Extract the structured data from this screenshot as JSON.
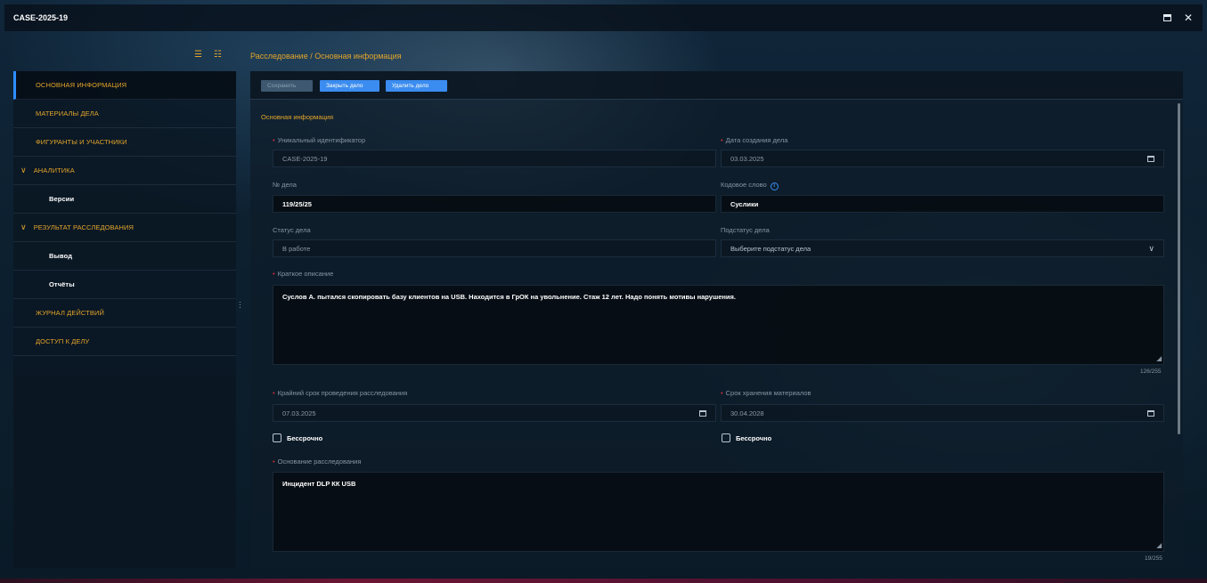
{
  "window": {
    "title": "CASE-2025-19"
  },
  "breadcrumb": "Расследование / Основная информация",
  "sidebar": {
    "items": [
      {
        "label": "ОСНОВНАЯ ИНФОРМАЦИЯ",
        "active": true
      },
      {
        "label": "МАТЕРИАЛЫ ДЕЛА"
      },
      {
        "label": "ФИГУРАНТЫ И УЧАСТНИКИ"
      },
      {
        "label": "АНАЛИТИКА",
        "expanded": true
      },
      {
        "label": "Версии"
      },
      {
        "label": "РЕЗУЛЬТАТ РАССЛЕДОВАНИЯ",
        "expanded": true
      },
      {
        "label": "Вывод"
      },
      {
        "label": "Отчёты"
      },
      {
        "label": "ЖУРНАЛ ДЕЙСТВИЙ"
      },
      {
        "label": "ДОСТУП К ДЕЛУ"
      }
    ]
  },
  "toolbar": {
    "save_label": "Сохранить",
    "close_label": "Закрыть дело",
    "delete_label": "Удалить дело"
  },
  "form": {
    "section_title": "Основная информация",
    "unique_id_label": "Уникальный идентификатор",
    "unique_id_value": "CASE-2025-19",
    "created_date_label": "Дата создания дела",
    "created_date_value": "03.03.2025",
    "case_no_label": "№ дела",
    "case_no_value": "119/25/25",
    "codeword_label": "Кодовое слово",
    "codeword_value": "Суслики",
    "status_label": "Статус дела",
    "status_value": "В работе",
    "substatus_label": "Подстатус дела",
    "substatus_placeholder": "Выберите подстатус дела",
    "description_label": "Краткое описание",
    "description_value": "Суслов А. пытался скопировать базу клиентов на USB. Находится в ГрОК на увольнение. Стаж 12 лет. Надо понять мотивы нарушения.",
    "description_counter": "126/255",
    "deadline_label": "Крайний срок проведения расследования",
    "deadline_value": "07.03.2025",
    "retention_label": "Срок хранения материалов",
    "retention_value": "30.04.2028",
    "indefinite_label": "Бессрочно",
    "basis_label": "Основание расследования",
    "basis_value": "Инцидент DLP КК USB",
    "basis_counter": "19/255"
  },
  "colors": {
    "accent": "#e3a52b",
    "primary_button": "#3b8cf0",
    "required": "#c6303c"
  }
}
